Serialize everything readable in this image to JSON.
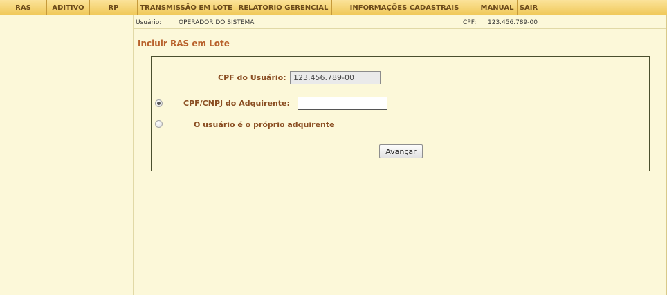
{
  "menu": [
    {
      "label": "RAS"
    },
    {
      "label": "ADITIVO"
    },
    {
      "label": "RP"
    },
    {
      "label": "TRANSMISSÃO EM LOTE"
    },
    {
      "label": "RELATORIO GERENCIAL"
    },
    {
      "label": "INFORMAÇÕES CADASTRAIS"
    },
    {
      "label": "MANUAL"
    },
    {
      "label": "SAIR"
    }
  ],
  "userbar": {
    "user_label": "Usuário:",
    "user_value": "OPERADOR DO SISTEMA",
    "cpf_label": "CPF:",
    "cpf_value": "123.456.789-00"
  },
  "page": {
    "title": "Incluir RAS em Lote"
  },
  "form": {
    "cpf_usuario_label": "CPF do Usuário:",
    "cpf_usuario_value": "123.456.789-00",
    "option_adquirente_label": "CPF/CNPJ do Adquirente:",
    "option_adquirente_value": "",
    "option_proprio_label": "O usuário é o próprio adquirente",
    "selected_option": "adquirente",
    "submit_label": "Avançar"
  },
  "colors": {
    "menu_bg": "#f0c95a",
    "page_bg": "#fcf8d9",
    "title": "#b8612b",
    "label": "#8a4e22"
  }
}
